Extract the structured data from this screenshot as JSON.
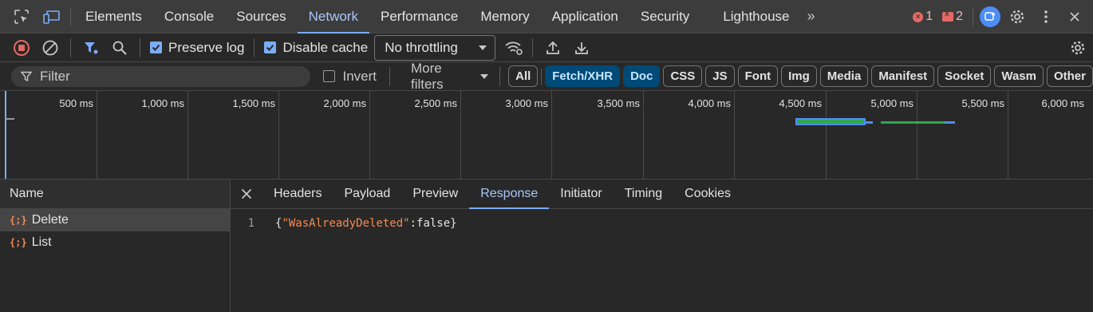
{
  "panel_tabs": [
    "Elements",
    "Console",
    "Sources",
    "Network",
    "Performance",
    "Memory",
    "Application",
    "Security",
    "Lighthouse"
  ],
  "active_panel": "Network",
  "more_tabs_glyph": "»",
  "errors_count": "1",
  "issues_count": "2",
  "toolbar": {
    "preserve_log_label": "Preserve log",
    "preserve_log_checked": true,
    "disable_cache_label": "Disable cache",
    "disable_cache_checked": true,
    "throttling_value": "No throttling"
  },
  "filter": {
    "placeholder": "Filter",
    "invert_label": "Invert",
    "more_filters_label": "More filters",
    "type_chips": [
      "All",
      "Fetch/XHR",
      "Doc",
      "CSS",
      "JS",
      "Font",
      "Img",
      "Media",
      "Manifest",
      "Socket",
      "Wasm",
      "Other"
    ],
    "selected_chips": [
      "Fetch/XHR",
      "Doc"
    ]
  },
  "timeline": {
    "ticks": [
      "500 ms",
      "1,000 ms",
      "1,500 ms",
      "2,000 ms",
      "2,500 ms",
      "3,000 ms",
      "3,500 ms",
      "4,000 ms",
      "4,500 ms",
      "5,000 ms",
      "5,500 ms",
      "6,000 ms"
    ],
    "colors": {
      "waiting": "#2fa84f",
      "download": "#4d8df7"
    }
  },
  "requests": {
    "header": "Name",
    "items": [
      {
        "name": "Delete",
        "icon": "{;}",
        "selected": true
      },
      {
        "name": "List",
        "icon": "{;}",
        "selected": false
      }
    ]
  },
  "detail": {
    "tabs": [
      "Headers",
      "Payload",
      "Preview",
      "Response",
      "Initiator",
      "Timing",
      "Cookies"
    ],
    "active_tab": "Response",
    "response": {
      "line_number": "1",
      "open_brace": "{",
      "key": "\"WasAlreadyDeleted\"",
      "colon_value": ":false",
      "close_brace": "}"
    }
  },
  "colors": {
    "accent": "#7cacf8",
    "json_key": "#f28b54",
    "error": "#e46962"
  }
}
